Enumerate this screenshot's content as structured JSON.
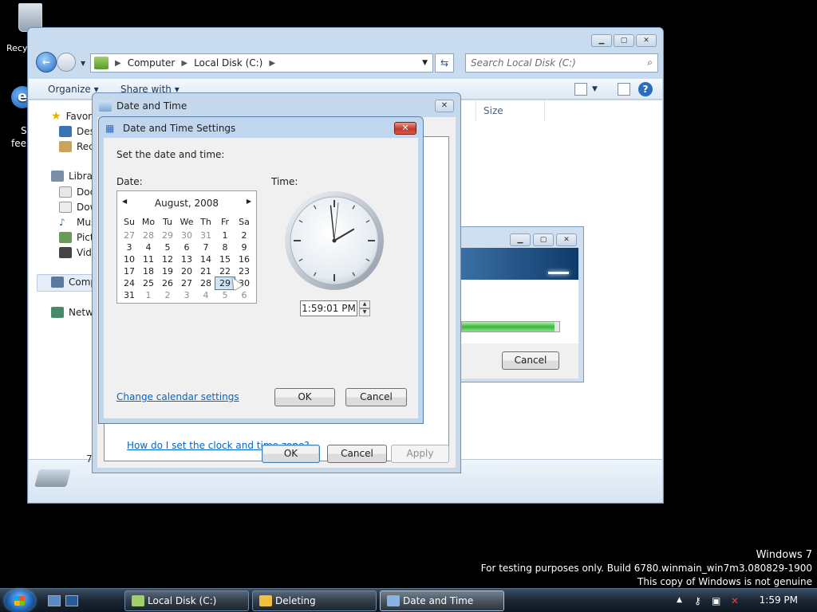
{
  "desktop": {
    "recycle_label": "Recy",
    "ie_label_1": "S",
    "ie_label_2": "fee"
  },
  "explorer": {
    "breadcrumb": [
      "Computer",
      "Local Disk (C:)"
    ],
    "search_placeholder": "Search Local Disk (C:)",
    "toolbar": {
      "organize": "Organize",
      "share_with": "Share with"
    },
    "column_size": "Size",
    "nav_items": [
      "Favori",
      "Desk",
      "Rece",
      "Librar",
      "Doc",
      "Dow",
      "Mus",
      "Pict",
      "Vide",
      "Comp",
      "Netwo"
    ],
    "details_text": "7"
  },
  "deleting_dialog": {
    "cancel": "Cancel",
    "progress": 0.95
  },
  "datetime_outer": {
    "title": "Date and Time",
    "help_link": "How do I set the clock and time zone?",
    "ok": "OK",
    "cancel": "Cancel",
    "apply": "Apply"
  },
  "datetime_settings": {
    "title": "Date and Time Settings",
    "intro": "Set the date and time:",
    "date_label": "Date:",
    "time_label": "Time:",
    "calendar": {
      "month": "August, 2008",
      "days_of_week": [
        "Su",
        "Mo",
        "Tu",
        "We",
        "Th",
        "Fr",
        "Sa"
      ],
      "days": [
        {
          "d": "27",
          "other": true
        },
        {
          "d": "28",
          "other": true
        },
        {
          "d": "29",
          "other": true
        },
        {
          "d": "30",
          "other": true
        },
        {
          "d": "31",
          "other": true
        },
        {
          "d": "1"
        },
        {
          "d": "2"
        },
        {
          "d": "3"
        },
        {
          "d": "4"
        },
        {
          "d": "5"
        },
        {
          "d": "6"
        },
        {
          "d": "7"
        },
        {
          "d": "8"
        },
        {
          "d": "9"
        },
        {
          "d": "10"
        },
        {
          "d": "11"
        },
        {
          "d": "12"
        },
        {
          "d": "13"
        },
        {
          "d": "14"
        },
        {
          "d": "15"
        },
        {
          "d": "16"
        },
        {
          "d": "17"
        },
        {
          "d": "18"
        },
        {
          "d": "19"
        },
        {
          "d": "20"
        },
        {
          "d": "21"
        },
        {
          "d": "22"
        },
        {
          "d": "23"
        },
        {
          "d": "24"
        },
        {
          "d": "25"
        },
        {
          "d": "26"
        },
        {
          "d": "27"
        },
        {
          "d": "28"
        },
        {
          "d": "29",
          "selected": true
        },
        {
          "d": "30"
        },
        {
          "d": "31"
        },
        {
          "d": "1",
          "other": true
        },
        {
          "d": "2",
          "other": true
        },
        {
          "d": "3",
          "other": true
        },
        {
          "d": "4",
          "other": true
        },
        {
          "d": "5",
          "other": true
        },
        {
          "d": "6",
          "other": true
        }
      ]
    },
    "time_value": "1:59:01 PM",
    "clock": {
      "hour": 13,
      "minute": 59,
      "second": 1
    },
    "calendar_link": "Change calendar settings",
    "ok": "OK",
    "cancel": "Cancel"
  },
  "watermark": {
    "line1": "Windows 7",
    "line2": "For testing purposes only. Build 6780.winmain_win7m3.080829-1900",
    "line3": "This copy of Windows is not genuine"
  },
  "taskbar": {
    "tasks": [
      {
        "label": "Local Disk (C:)",
        "active": false
      },
      {
        "label": "Deleting",
        "active": false
      },
      {
        "label": "Date and Time",
        "active": true
      }
    ],
    "clock": "1:59 PM"
  }
}
